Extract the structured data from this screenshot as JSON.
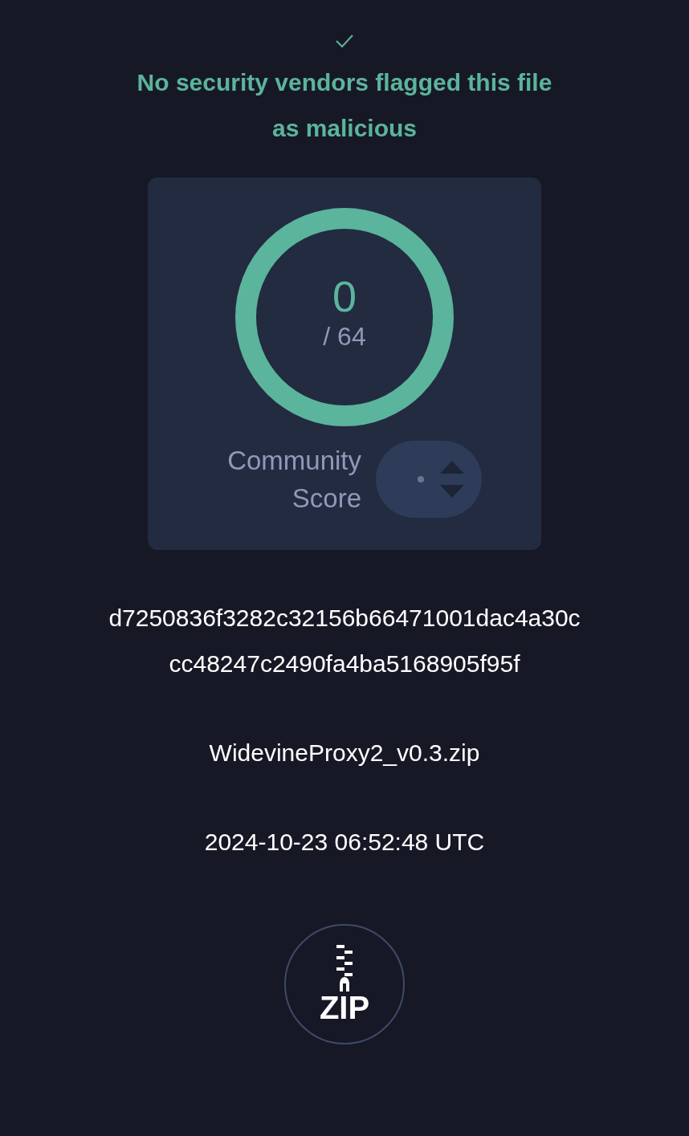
{
  "verdict": {
    "text": "No security vendors flagged this file as malicious"
  },
  "detections": {
    "count": "0",
    "total": "/ 64"
  },
  "community_score": {
    "label": "Community Score"
  },
  "file": {
    "hash_lines": [
      "d7250836f3282c32156b66471001dac4a30c",
      "cc48247c2490fa4ba5168905f95f"
    ],
    "name": "WidevineProxy2_v0.3.zip",
    "date": "2024-10-23 06:52:48 UTC",
    "type_label": "ZIP"
  }
}
